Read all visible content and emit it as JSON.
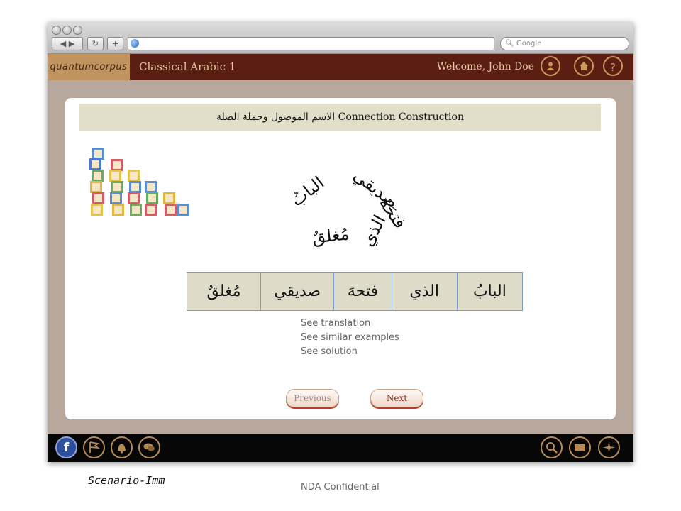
{
  "browser": {
    "search_placeholder": "Google",
    "back_forward": "◀ ▶",
    "reload": "↻",
    "add_tab": "+"
  },
  "header": {
    "logo": "quantumcorpus",
    "course": "Classical Arabic 1",
    "welcome": "Welcome, John Doe",
    "help": "?"
  },
  "lesson": {
    "title": "الاسم الموصول وجملة الصلة Connection Construction",
    "scattered_words": [
      "البابُ",
      "صديقي",
      "فتحَهُ",
      "الذي",
      "مُغلقٌ"
    ],
    "answer_words": [
      "البابُ",
      "الذي",
      "فتحهَ",
      "صديقي",
      "مُغلقٌ"
    ],
    "links": [
      "See translation",
      "See similar examples",
      "See solution"
    ],
    "previous": "Previous",
    "next": "Next"
  },
  "footer": {
    "facebook": "f"
  },
  "caption": "Scenario-Imm",
  "confidential": "NDA Confidential",
  "colors": {
    "header_bg": "#5b1e12",
    "logo_bg": "#c0935f",
    "frame_bg": "#b8a79d",
    "title_bg": "#e1dfc8",
    "table_bg": "#dedcc9",
    "accent_gold": "#c79a5b"
  }
}
